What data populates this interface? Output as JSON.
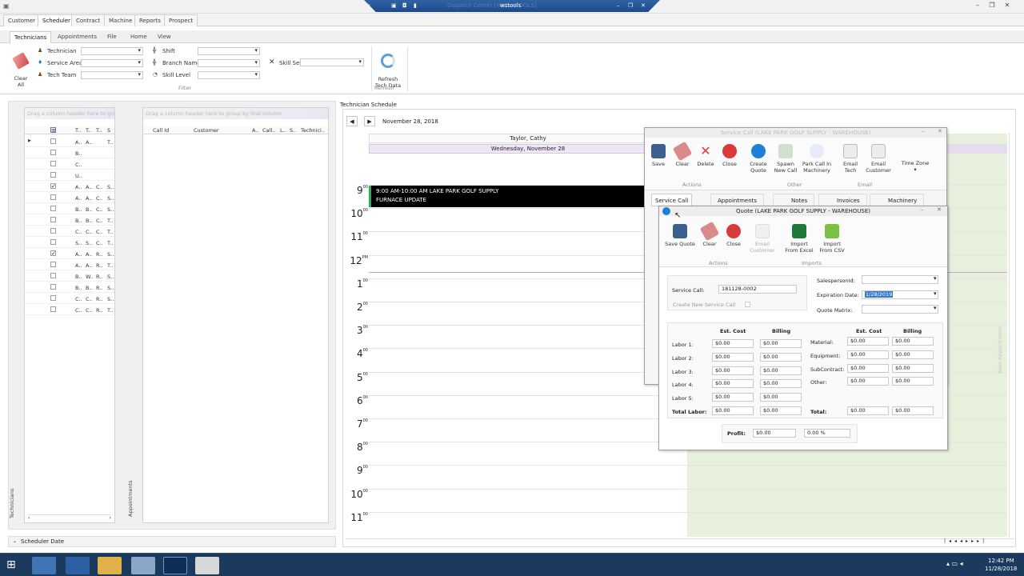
{
  "window": {
    "title": "wstools",
    "ghost_title": "Dispatch Center [WSTwsTOOLS]"
  },
  "menu_tabs": [
    "Customer",
    "Scheduler",
    "Contract",
    "Machine",
    "Reports",
    "Prospect"
  ],
  "ribbon_tabs": [
    "Technicians",
    "Appointments",
    "File",
    "Home",
    "View"
  ],
  "filter": {
    "clear_all": "Clear\nAll",
    "technician": "Technician",
    "service_area": "Service Area",
    "tech_team": "Tech Team",
    "shift": "Shift",
    "branch_name": "Branch Name",
    "skill_level": "Skill Level",
    "skill_set": "Skill Set",
    "group_label": "Filter",
    "refresh": "Refresh\nTech Data",
    "refresh_group": "Refresh"
  },
  "tech_grid": {
    "drag_hint": "Drag a column header here to group by that column",
    "headers": [
      "T..",
      "T..",
      "T..",
      "S"
    ],
    "rows": [
      {
        "checked": false,
        "cells": [
          "A..",
          "A..",
          "",
          "T.."
        ]
      },
      {
        "checked": false,
        "cells": [
          "B..",
          "",
          "",
          ""
        ]
      },
      {
        "checked": false,
        "cells": [
          "C..",
          "",
          "",
          ""
        ]
      },
      {
        "checked": false,
        "cells": [
          "U..",
          "",
          "",
          ""
        ]
      },
      {
        "checked": true,
        "cells": [
          "A..",
          "A..",
          "C..",
          "S.."
        ]
      },
      {
        "checked": false,
        "cells": [
          "A..",
          "A..",
          "C..",
          "S.."
        ]
      },
      {
        "checked": false,
        "cells": [
          "B..",
          "B..",
          "C..",
          "S.."
        ]
      },
      {
        "checked": false,
        "cells": [
          "B..",
          "B..",
          "C..",
          "T.."
        ]
      },
      {
        "checked": false,
        "cells": [
          "C..",
          "C..",
          "C..",
          "T.."
        ]
      },
      {
        "checked": false,
        "cells": [
          "S..",
          "S..",
          "C..",
          "T.."
        ]
      },
      {
        "checked": true,
        "cells": [
          "A..",
          "A..",
          "R..",
          "S.."
        ]
      },
      {
        "checked": false,
        "cells": [
          "A..",
          "A..",
          "R..",
          "T.."
        ]
      },
      {
        "checked": false,
        "cells": [
          "B..",
          "W..",
          "R..",
          "S.."
        ]
      },
      {
        "checked": false,
        "cells": [
          "B..",
          "B..",
          "R..",
          "S.."
        ]
      },
      {
        "checked": false,
        "cells": [
          "C..",
          "C..",
          "R..",
          "S.."
        ]
      },
      {
        "checked": false,
        "cells": [
          "C..",
          "C..",
          "R..",
          "T.."
        ]
      }
    ],
    "side_label": "Technicians"
  },
  "appt_grid": {
    "drag_hint": "Drag a column header here to group by that column",
    "headers": [
      "Call Id",
      "Customer",
      "A..",
      "Call..",
      "L..",
      "S..",
      "Technici.."
    ],
    "side_label": "Appointments"
  },
  "scheduler_date": "Scheduler Date",
  "schedule": {
    "section_title": "Technician Schedule",
    "date": "November 28, 2018",
    "tech_name": "Taylor, Cathy",
    "day_label": "Wednesday, November 28",
    "appointment_line1": "9:00 AM-10:00 AM LAKE PARK GOLF SUPPLY",
    "appointment_line2": "FURNACE UPDATE",
    "hours": [
      {
        "h": "9",
        "s": "00"
      },
      {
        "h": "10",
        "s": "00"
      },
      {
        "h": "11",
        "s": "00"
      },
      {
        "h": "12",
        "s": "PM"
      },
      {
        "h": "1",
        "s": "00"
      },
      {
        "h": "2",
        "s": "00"
      },
      {
        "h": "3",
        "s": "00"
      },
      {
        "h": "4",
        "s": "00"
      },
      {
        "h": "5",
        "s": "00"
      },
      {
        "h": "6",
        "s": "00"
      },
      {
        "h": "7",
        "s": "00"
      },
      {
        "h": "8",
        "s": "00"
      },
      {
        "h": "9",
        "s": "00"
      },
      {
        "h": "10",
        "s": "00"
      },
      {
        "h": "11",
        "s": "00"
      }
    ],
    "next_appt": "Next Appointment"
  },
  "service_call": {
    "title": "Service Call (LAKE PARK GOLF SUPPLY - WAREHOUSE)",
    "buttons": [
      "Save",
      "Clear",
      "Delete",
      "Close",
      "Create\nQuote",
      "Spawn\nNew Call",
      "Park Call In\nMachinery",
      "Email\nTech",
      "Email\nCustomer",
      "Time Zone"
    ],
    "groups": [
      "Actions",
      "Other",
      "Email"
    ],
    "tabs": [
      "Service Call",
      "Appointments",
      "Notes",
      "Invoices",
      "Machinery"
    ]
  },
  "quote": {
    "title": "Quote (LAKE PARK GOLF SUPPLY - WAREHOUSE)",
    "buttons": [
      "Save Quote",
      "Clear",
      "Close",
      "Email\nCustomer",
      "Import\nFrom Excel",
      "Import\nFrom CSV"
    ],
    "groups": [
      "Actions",
      "Imports"
    ],
    "service_call_label": "Service Call:",
    "service_call_value": "181128-0002",
    "create_new": "Create New Service Call",
    "salesperson": "SalespersonId:",
    "expiration": "Expiration Date:",
    "expiration_value": "1/28/2019",
    "quote_matrix": "Quote Matrix:",
    "est_cost": "Est. Cost",
    "billing": "Billing",
    "labor": [
      {
        "label": "Labor 1:",
        "cost": "$0.00",
        "bill": "$0.00"
      },
      {
        "label": "Labor 2:",
        "cost": "$0.00",
        "bill": "$0.00"
      },
      {
        "label": "Labor 3:",
        "cost": "$0.00",
        "bill": "$0.00"
      },
      {
        "label": "Labor 4:",
        "cost": "$0.00",
        "bill": "$0.00"
      },
      {
        "label": "Labor 5:",
        "cost": "$0.00",
        "bill": "$0.00"
      }
    ],
    "total_labor": {
      "label": "Total Labor:",
      "cost": "$0.00",
      "bill": "$0.00"
    },
    "other": [
      {
        "label": "Material:",
        "cost": "$0.00",
        "bill": "$0.00"
      },
      {
        "label": "Equipment:",
        "cost": "$0.00",
        "bill": "$0.00"
      },
      {
        "label": "SubContract:",
        "cost": "$0.00",
        "bill": "$0.00"
      },
      {
        "label": "Other:",
        "cost": "$0.00",
        "bill": "$0.00"
      }
    ],
    "total": {
      "label": "Total:",
      "cost": "$0.00",
      "bill": "$0.00"
    },
    "profit_label": "Profit:",
    "profit_value": "$0.00",
    "profit_pct": "0.00 %"
  },
  "taskbar": {
    "time": "12:42 PM",
    "date": "11/28/2018"
  },
  "colors": {
    "accent": "#2c5d9f",
    "appointment_bg": "#000000",
    "green_area": "#e6f0dc",
    "save_icon": "#3b5f8f",
    "delete_icon": "#d93a3a",
    "quote_icon": "#1e7fd6",
    "excel_icon": "#1f7a3a"
  }
}
